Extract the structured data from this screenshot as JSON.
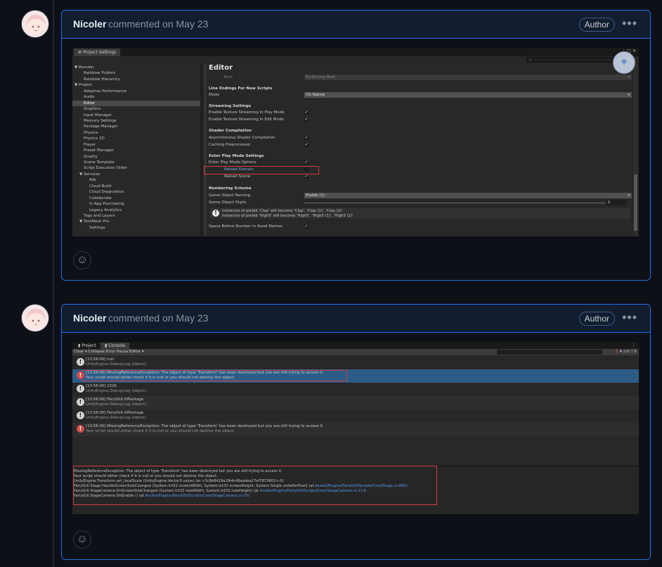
{
  "comments": [
    {
      "author": "Nicoler",
      "meta": "commented on May 23",
      "badge": "Author",
      "menu": "•••",
      "reaction": "☺"
    },
    {
      "author": "Nicoler",
      "meta": "commented on May 23",
      "badge": "Author",
      "menu": "•••",
      "reaction": "☺"
    }
  ],
  "project_settings": {
    "tab": "⚙ Project Settings",
    "window_controls": "⋮□✕",
    "tree": [
      "▼ Borodar",
      "Rainbow Folders",
      "Rainbow Hierarchy",
      "▼ Project",
      "Adaptive Performance",
      "Audio",
      "Editor",
      "Graphics",
      "Input Manager",
      "Memory Settings",
      "Package Manager",
      "Physics",
      "Physics 2D",
      "Player",
      "Preset Manager",
      "Quality",
      "Scene Template",
      "Script Execution Order",
      "▼ Services",
      "Ads",
      "Cloud Build",
      "Cloud Diagnostics",
      "Collaborate",
      "In-App Purchasing",
      "Legacy Analytics",
      "Tags and Layers",
      "▼ TextMesh Pro",
      "Settings"
    ],
    "title": "Editor",
    "best_label": "Best",
    "best_value": "Etc2Comp Best",
    "line_endings_head": "Line Endings For New Scripts",
    "mode_label": "Mode",
    "mode_value": "OS Native",
    "streaming_head": "Streaming Settings",
    "streaming_play": "Enable Texture Streaming In Play Mode",
    "streaming_edit": "Enable Texture Streaming In Edit Mode",
    "shader_head": "Shader Compilation",
    "async_shader": "Asynchronous Shader Compilation",
    "caching_pre": "Caching Preprocessor",
    "enter_play_head": "Enter Play Mode Settings",
    "enter_play_opts": "Enter Play Mode Options",
    "reload_domain": "Reload Domain",
    "reload_scene": "Reload Scene",
    "numbering_head": "Numbering Scheme",
    "go_naming": "Game Object Naming",
    "go_naming_value": "Prefab (1)",
    "go_digits": "Game Object Digits",
    "go_digits_value": "1",
    "info_line1": "Instances of prefab 'Clap' will become 'Clap', 'Clap (1)', 'Clap (2)'",
    "info_line2": "Instances of prefab 'High5' will become 'High5', 'High5 (1)', 'High5 (2)'",
    "space_before": "Space Before Number in Asset Names",
    "check": "✓",
    "arrow": "▾",
    "info_icon": "!",
    "capture_icon": "⌖"
  },
  "console": {
    "tab_project": "▮ Project",
    "tab_console": "▮ Console",
    "toolbar": "Clear ▾   Collapse   Error Pause   Editor ▾",
    "counts": "❗4  ⚠0  ⓘ2",
    "menu": "⋮",
    "entries": [
      {
        "line1": "[13:56:00] null",
        "line2": "UnityEngine.Debug:Log (object)",
        "type": "info"
      },
      {
        "line1": "[13:56:00] MissingReferenceException: The object of type 'Transform' has been destroyed but you are still trying to access it.",
        "line2": "Your script should either check if it is null or you should not destroy the object.",
        "type": "err"
      },
      {
        "line1": "[13:56:00] 2326",
        "line2": "UnityEngine.Debug:Log (object)",
        "type": "info"
      },
      {
        "line1": "[13:56:00] FairyGUI.UIPackage",
        "line2": "UnityEngine.Debug:Log (object)",
        "type": "info"
      },
      {
        "line1": "[13:56:00] FairyGUI.UIPackage",
        "line2": "UnityEngine.Debug:Log (object)",
        "type": "info"
      },
      {
        "line1": "[13:56:00] MissingReferenceException: The object of type 'Transform' has been destroyed but you are still trying to access it.",
        "line2": "Your script should either check if it is null or you should not destroy the object.",
        "type": "err"
      }
    ],
    "detail": [
      "MissingReferenceException: The object of type 'Transform' has been destroyed but you are still trying to access it.",
      "Your script should either check if it is null or you should not destroy the object.",
      "UnityEngine.Transform.set_localScale (UnityEngine.Vector3 value) (at <3c9b8419a1fb4c49aadea27ef7873601>:0)",
      "FairyGUI.Stage.HandleScreenSizeChanged (System.Int32 screenWidth, System.Int32 screenHeight, System.Single unitsPerPixel) (at",
      "FairyGUI.StageCamera.OnScreenSizeChanged (System.Int32 newWidth, System.Int32 newHeight) (at",
      "FairyGUI.StageCamera.OnEnable () (at"
    ],
    "detail_links": [
      "Assets/Plugins/FairyGUI/Scripts/Core/Stage.cs:860)",
      "Assets/Plugins/FairyGUI/Scripts/Core/StageCamera.cs:113)",
      "Assets/Plugins/FairyGUI/Scripts/Core/StageCamera.cs:70)"
    ]
  }
}
